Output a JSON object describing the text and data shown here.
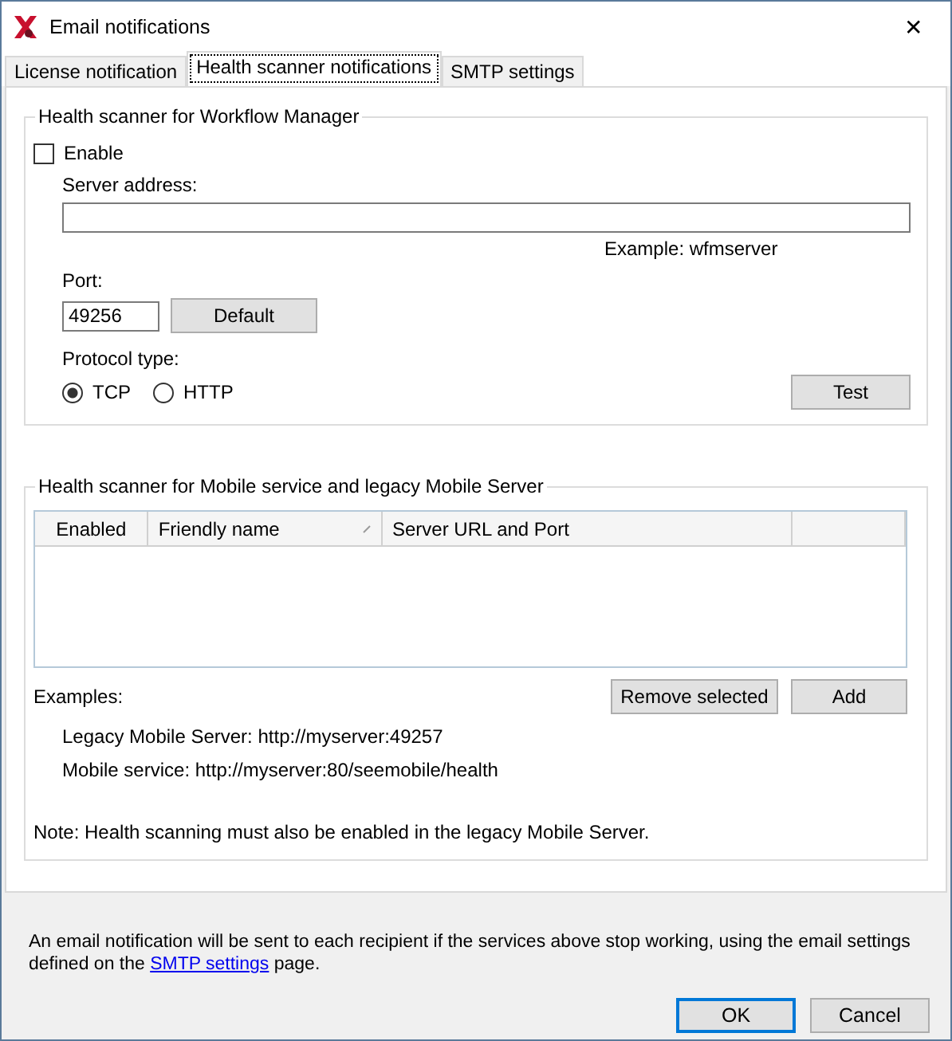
{
  "window": {
    "title": "Email notifications",
    "close": "✕"
  },
  "tabs": [
    {
      "label": "License notification",
      "selected": false
    },
    {
      "label": "Health scanner notifications",
      "selected": true
    },
    {
      "label": "SMTP settings",
      "selected": false
    }
  ],
  "workflow_group": {
    "title": "Health scanner for Workflow Manager",
    "enable": {
      "label": "Enable",
      "checked": false
    },
    "server_address": {
      "label": "Server address:",
      "example": "Example: wfmserver"
    },
    "port": {
      "label": "Port:",
      "value": "49256",
      "default_button": "Default"
    },
    "protocol": {
      "label": "Protocol type:",
      "options": [
        {
          "label": "TCP",
          "selected": true
        },
        {
          "label": "HTTP",
          "selected": false
        }
      ]
    },
    "test_button": "Test"
  },
  "mobile_group": {
    "title": "Health scanner for Mobile service and legacy Mobile Server",
    "table": {
      "columns": [
        "Enabled",
        "Friendly name",
        "Server URL and Port"
      ]
    },
    "examples_label": "Examples:",
    "remove_button": "Remove selected",
    "add_button": "Add",
    "examples": [
      "Legacy Mobile Server: http://myserver:49257",
      "Mobile service: http://myserver:80/seemobile/health"
    ],
    "note": "Note: Health scanning must also be enabled in the legacy Mobile Server."
  },
  "footer": {
    "before": "An email notification will be sent to each recipient if the services above stop working, using the email settings defined on the ",
    "link": "SMTP settings",
    "after": " page."
  },
  "buttons": [
    {
      "label": "OK",
      "kind": "default"
    },
    {
      "label": "Cancel",
      "kind": "normal"
    }
  ]
}
